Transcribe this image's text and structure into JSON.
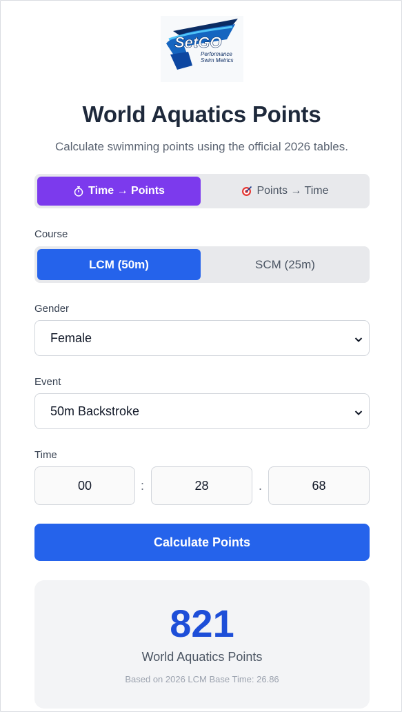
{
  "logo": {
    "brand": "SetGO",
    "tagline_1": "Performance",
    "tagline_2": "Swim Metrics"
  },
  "header": {
    "title": "World Aquatics Points",
    "subtitle": "Calculate swimming points using the official 2026 tables."
  },
  "mode_tabs": {
    "time_to_points": {
      "icon": "stopwatch-icon",
      "label": "Time → Points",
      "active": true
    },
    "points_to_time": {
      "icon": "target-icon",
      "label": "Points → Time",
      "active": false
    }
  },
  "course": {
    "label": "Course",
    "lcm": {
      "label": "LCM (50m)",
      "active": true
    },
    "scm": {
      "label": "SCM (25m)",
      "active": false
    }
  },
  "gender": {
    "label": "Gender",
    "value": "Female"
  },
  "event": {
    "label": "Event",
    "value": "50m Backstroke"
  },
  "time": {
    "label": "Time",
    "minutes": "00",
    "seconds": "28",
    "hundredths": "68",
    "sep1": ":",
    "sep2": "."
  },
  "calculate_button": "Calculate Points",
  "result": {
    "points": "821",
    "label": "World Aquatics Points",
    "base_note": "Based on 2026 LCM Base Time: 26.86"
  },
  "colors": {
    "purple_accent": "#7c3aed",
    "blue_accent": "#2563eb",
    "points_blue": "#1d4ed8"
  }
}
